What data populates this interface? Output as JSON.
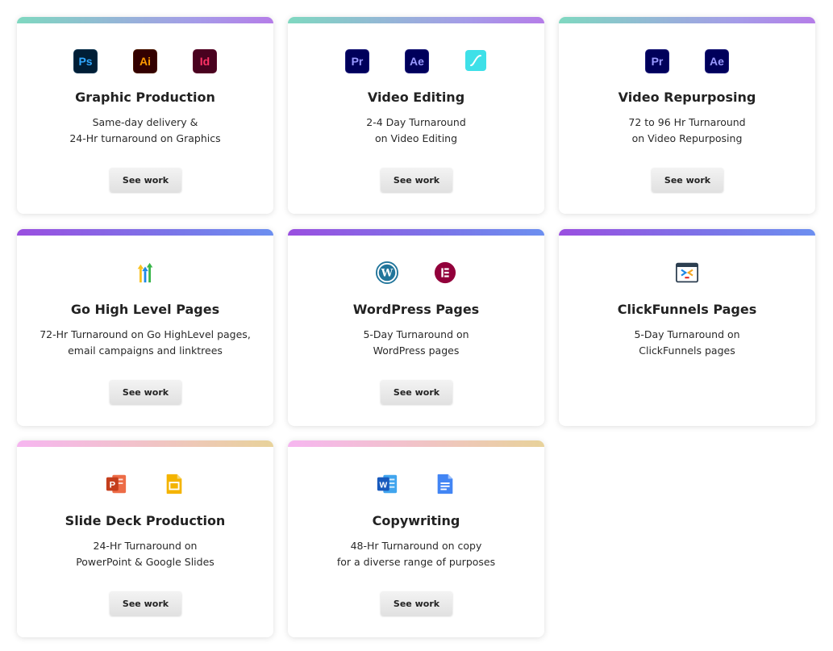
{
  "services": [
    {
      "title": "Graphic Production",
      "lines": [
        "Same-day delivery &",
        "24-Hr turnaround on Graphics"
      ],
      "button": "See work",
      "icons": [
        {
          "name": "photoshop-icon",
          "text": "Ps"
        },
        {
          "name": "illustrator-icon",
          "text": "Ai"
        },
        {
          "name": "indesign-icon",
          "text": "Id"
        }
      ]
    },
    {
      "title": "Video Editing",
      "lines": [
        "2-4 Day Turnaround",
        "on Video Editing"
      ],
      "button": "See work",
      "icons": [
        {
          "name": "premiere-pro-icon",
          "text": "Pr"
        },
        {
          "name": "after-effects-icon",
          "text": "Ae"
        },
        {
          "name": "motion-graphics-icon",
          "text": ""
        }
      ]
    },
    {
      "title": "Video Repurposing",
      "lines": [
        "72 to 96 Hr Turnaround",
        "on Video Repurposing"
      ],
      "button": "See work",
      "icons": [
        {
          "name": "premiere-pro-icon",
          "text": "Pr"
        },
        {
          "name": "after-effects-icon",
          "text": "Ae"
        }
      ]
    },
    {
      "title": "Go High Level Pages",
      "lines": [
        "72-Hr Turnaround on Go HighLevel pages,",
        "email campaigns and linktrees"
      ],
      "button": "See work",
      "icons": [
        {
          "name": "gohighlevel-icon",
          "text": ""
        }
      ]
    },
    {
      "title": "WordPress Pages",
      "lines": [
        "5-Day Turnaround on",
        "WordPress pages"
      ],
      "button": "See work",
      "icons": [
        {
          "name": "wordpress-icon",
          "text": ""
        },
        {
          "name": "elementor-icon",
          "text": ""
        }
      ]
    },
    {
      "title": "ClickFunnels Pages",
      "lines": [
        "5-Day Turnaround on",
        "ClickFunnels pages"
      ],
      "icons": [
        {
          "name": "clickfunnels-icon",
          "text": ""
        }
      ]
    },
    {
      "title": "Slide Deck Production",
      "lines": [
        "24-Hr Turnaround on",
        "PowerPoint & Google Slides"
      ],
      "button": "See work",
      "icons": [
        {
          "name": "powerpoint-icon",
          "text": ""
        },
        {
          "name": "google-slides-icon",
          "text": ""
        }
      ]
    },
    {
      "title": "Copywriting",
      "lines": [
        "48-Hr Turnaround on copy",
        "for a diverse range of purposes"
      ],
      "button": "See work",
      "icons": [
        {
          "name": "word-icon",
          "text": ""
        },
        {
          "name": "google-docs-icon",
          "text": ""
        }
      ]
    }
  ]
}
